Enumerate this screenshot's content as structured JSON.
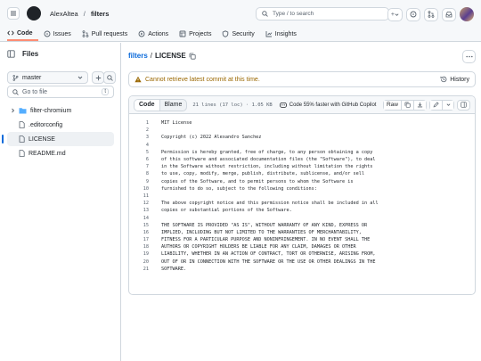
{
  "header": {
    "owner": "AlexAltea",
    "separator": "/",
    "repo": "filters",
    "search_placeholder": "Type / to search",
    "plus_label": "+"
  },
  "nav": {
    "tabs": [
      {
        "label": "Code",
        "icon": "code-icon",
        "active": true
      },
      {
        "label": "Issues",
        "icon": "issue-icon"
      },
      {
        "label": "Pull requests",
        "icon": "pull-request-icon"
      },
      {
        "label": "Actions",
        "icon": "play-icon"
      },
      {
        "label": "Projects",
        "icon": "table-icon"
      },
      {
        "label": "Security",
        "icon": "shield-icon"
      },
      {
        "label": "Insights",
        "icon": "graph-icon"
      }
    ]
  },
  "sidebar": {
    "title": "Files",
    "branch": "master",
    "goto_placeholder": "Go to file",
    "goto_shortcut": "t",
    "items": [
      {
        "label": "filter-chromium",
        "type": "folder"
      },
      {
        "label": ".editorconfig",
        "type": "file"
      },
      {
        "label": "LICENSE",
        "type": "file",
        "selected": true
      },
      {
        "label": "README.md",
        "type": "file"
      }
    ]
  },
  "file": {
    "repo_link": "filters",
    "path_sep": "/",
    "name": "LICENSE",
    "warning": "Cannot retrieve latest commit at this time.",
    "history": "History",
    "tab_code": "Code",
    "tab_blame": "Blame",
    "meta": "21 lines (17 loc) · 1.05 KB",
    "copilot": "Code 55% faster with GitHub Copilot",
    "raw": "Raw"
  },
  "code_lines": [
    {
      "n": "1",
      "t": "MIT License"
    },
    {
      "n": "2",
      "t": ""
    },
    {
      "n": "3",
      "t": "Copyright (c) 2022 Alexandro Sanchez"
    },
    {
      "n": "4",
      "t": ""
    },
    {
      "n": "5",
      "t": "Permission is hereby granted, free of charge, to any person obtaining a copy"
    },
    {
      "n": "6",
      "t": "of this software and associated documentation files (the \"Software\"), to deal"
    },
    {
      "n": "7",
      "t": "in the Software without restriction, including without limitation the rights"
    },
    {
      "n": "8",
      "t": "to use, copy, modify, merge, publish, distribute, sublicense, and/or sell"
    },
    {
      "n": "9",
      "t": "copies of the Software, and to permit persons to whom the Software is"
    },
    {
      "n": "10",
      "t": "furnished to do so, subject to the following conditions:"
    },
    {
      "n": "11",
      "t": ""
    },
    {
      "n": "12",
      "t": "The above copyright notice and this permission notice shall be included in all"
    },
    {
      "n": "13",
      "t": "copies or substantial portions of the Software."
    },
    {
      "n": "14",
      "t": ""
    },
    {
      "n": "15",
      "t": "THE SOFTWARE IS PROVIDED \"AS IS\", WITHOUT WARRANTY OF ANY KIND, EXPRESS OR"
    },
    {
      "n": "16",
      "t": "IMPLIED, INCLUDING BUT NOT LIMITED TO THE WARRANTIES OF MERCHANTABILITY,"
    },
    {
      "n": "17",
      "t": "FITNESS FOR A PARTICULAR PURPOSE AND NONINFRINGEMENT. IN NO EVENT SHALL THE"
    },
    {
      "n": "18",
      "t": "AUTHORS OR COPYRIGHT HOLDERS BE LIABLE FOR ANY CLAIM, DAMAGES OR OTHER"
    },
    {
      "n": "19",
      "t": "LIABILITY, WHETHER IN AN ACTION OF CONTRACT, TORT OR OTHERWISE, ARISING FROM,"
    },
    {
      "n": "20",
      "t": "OUT OF OR IN CONNECTION WITH THE SOFTWARE OR THE USE OR OTHER DEALINGS IN THE"
    },
    {
      "n": "21",
      "t": "SOFTWARE."
    }
  ],
  "colors": {
    "accent": "#0969da",
    "tab_underline": "#fd8c73",
    "warning": "#9a6700",
    "folder": "#54aeff"
  }
}
